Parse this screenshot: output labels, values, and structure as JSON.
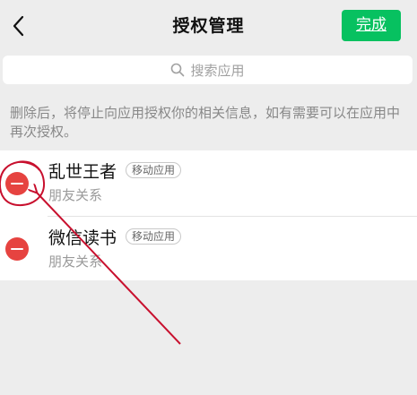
{
  "header": {
    "back_icon": "chevron-left-icon",
    "title": "授权管理",
    "done_label": "完成",
    "accent_color": "#07c160"
  },
  "search": {
    "icon": "search-icon",
    "placeholder": "搜索应用"
  },
  "notice": "删除后，将停止向应用授权你的相关信息，如有需要可以在应用中再次授权。",
  "apps": [
    {
      "name": "乱世王者",
      "tag": "移动应用",
      "permission": "朋友关系",
      "remove_icon": "minus-circle-icon"
    },
    {
      "name": "微信读书",
      "tag": "移动应用",
      "permission": "朋友关系",
      "remove_icon": "minus-circle-icon"
    }
  ],
  "colors": {
    "remove": "#e64340",
    "annotation": "#c8102e"
  }
}
